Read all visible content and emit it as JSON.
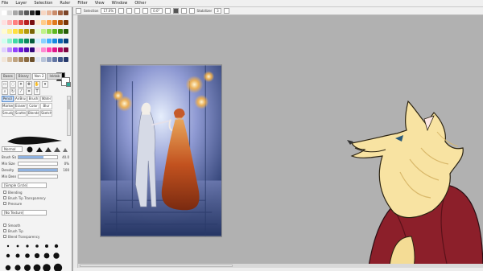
{
  "menu": {
    "items": [
      "File",
      "Layer",
      "Selection",
      "Ruler",
      "Filter",
      "View",
      "Window",
      "Other"
    ]
  },
  "toolbar": {
    "selection_label": "Selection",
    "zoom_value": "17.0%",
    "angle_value": "0.0°",
    "stabilizer_label": "Stabilizer",
    "stabilizer_value": "3"
  },
  "panel_tabs": [
    "Bases",
    "Binary",
    "Nan 2",
    "Inktab"
  ],
  "tool_grid": [
    "Pencil",
    "AirBrush",
    "Brush",
    "Water",
    "Marker",
    "Eraser",
    "Color",
    "Blur",
    "Smudge",
    "Scatter",
    "Blender",
    "Sketch"
  ],
  "brush": {
    "mode_label": "Normal",
    "props": [
      {
        "label": "Brush Size",
        "value": "40.0",
        "fill": 0.65
      },
      {
        "label": "Min Size",
        "value": "0%",
        "fill": 0.0
      },
      {
        "label": "Density",
        "value": "100",
        "fill": 1.0
      },
      {
        "label": "Min Density",
        "value": "",
        "fill": 0.0
      }
    ],
    "shape_select": "[Simple Circle]",
    "texture_select": "[No Texture]",
    "checks": [
      "Blending",
      "Brush Tip Transparency",
      "Pressure",
      "Smooth",
      "Brush Tip",
      "Blend Transparency"
    ]
  },
  "colors": {
    "accent": "#5b8fd1",
    "panel_bg": "#f3f3f3",
    "workspace_bg": "#b1b1b1"
  }
}
